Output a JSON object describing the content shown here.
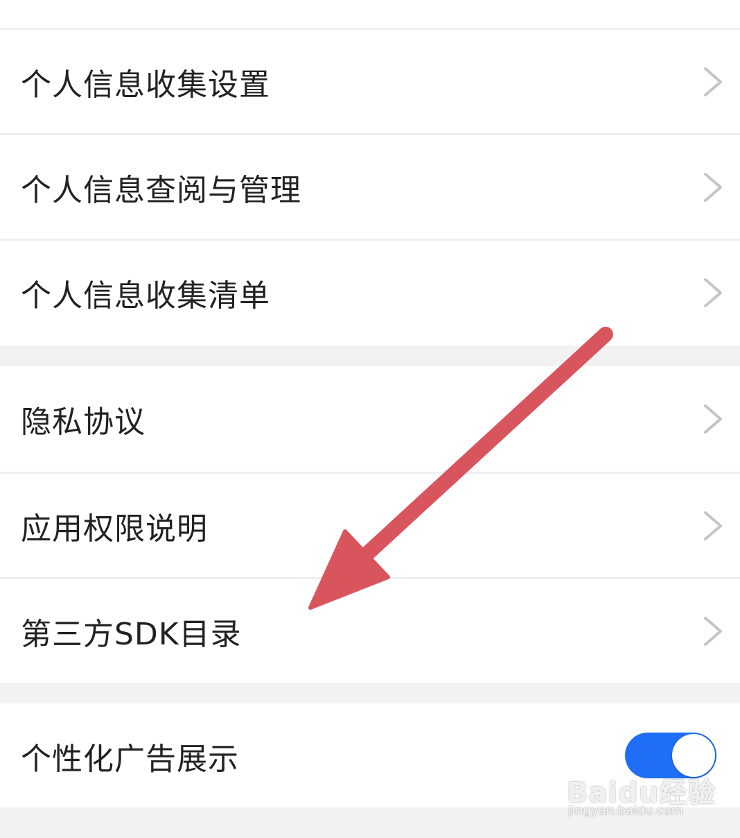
{
  "groups": [
    {
      "items": [
        {
          "label": "个人信息收集设置",
          "control": "chevron"
        },
        {
          "label": "个人信息查阅与管理",
          "control": "chevron"
        },
        {
          "label": "个人信息收集清单",
          "control": "chevron"
        }
      ]
    },
    {
      "items": [
        {
          "label": "隐私协议",
          "control": "chevron"
        },
        {
          "label": "应用权限说明",
          "control": "chevron"
        },
        {
          "label": "第三方SDK目录",
          "control": "chevron"
        }
      ]
    },
    {
      "items": [
        {
          "label": "个性化广告展示",
          "control": "toggle",
          "toggle_on": true
        }
      ]
    }
  ],
  "colors": {
    "toggle_on": "#1f6ef5",
    "annotation_arrow": "#d9555e",
    "chevron": "#c4c4c4",
    "label_text": "#222222"
  },
  "watermark": {
    "logo": "Baidu经验",
    "url": "jingyan.baidu.com"
  }
}
